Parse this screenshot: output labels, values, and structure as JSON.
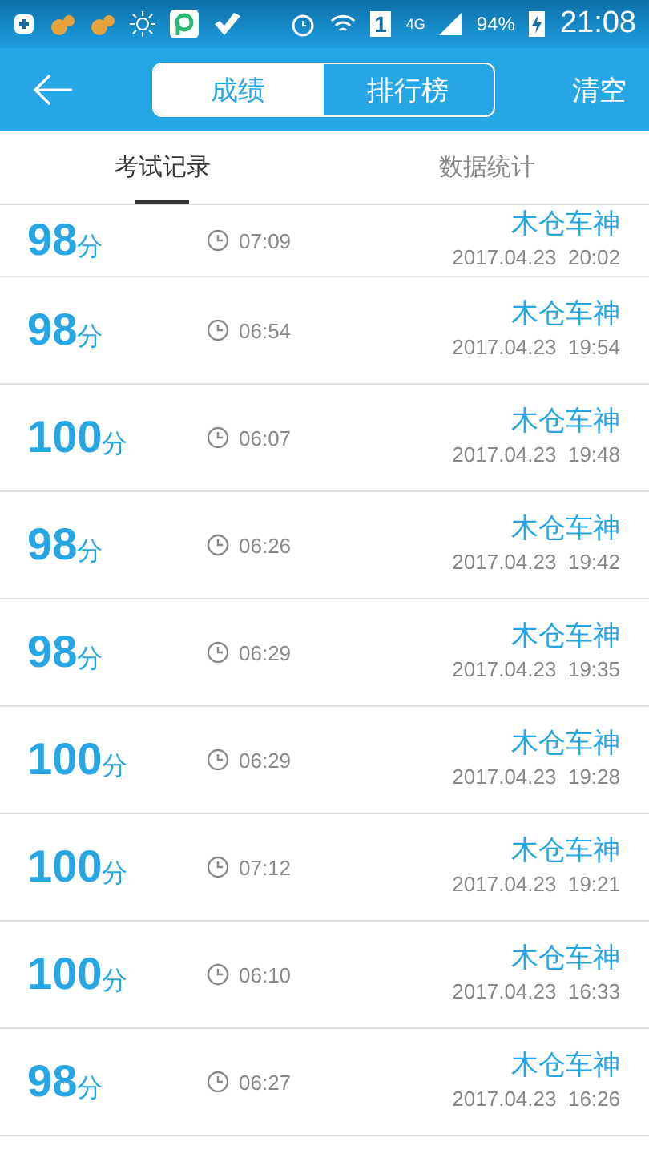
{
  "status_bar": {
    "sim": "1",
    "network": "4G",
    "battery": "94%",
    "time": "21:08"
  },
  "header": {
    "segments": [
      {
        "label": "成绩",
        "selected": true
      },
      {
        "label": "排行榜",
        "selected": false
      }
    ],
    "action": "清空"
  },
  "tabs": [
    {
      "label": "考试记录",
      "selected": true
    },
    {
      "label": "数据统计",
      "selected": false
    }
  ],
  "records": [
    {
      "score": "98",
      "unit": "分",
      "duration": "07:09",
      "name": "木仓车神",
      "date": "2017.04.23  20:02"
    },
    {
      "score": "98",
      "unit": "分",
      "duration": "06:54",
      "name": "木仓车神",
      "date": "2017.04.23  19:54"
    },
    {
      "score": "100",
      "unit": "分",
      "duration": "06:07",
      "name": "木仓车神",
      "date": "2017.04.23  19:48"
    },
    {
      "score": "98",
      "unit": "分",
      "duration": "06:26",
      "name": "木仓车神",
      "date": "2017.04.23  19:42"
    },
    {
      "score": "98",
      "unit": "分",
      "duration": "06:29",
      "name": "木仓车神",
      "date": "2017.04.23  19:35"
    },
    {
      "score": "100",
      "unit": "分",
      "duration": "06:29",
      "name": "木仓车神",
      "date": "2017.04.23  19:28"
    },
    {
      "score": "100",
      "unit": "分",
      "duration": "07:12",
      "name": "木仓车神",
      "date": "2017.04.23  19:21"
    },
    {
      "score": "100",
      "unit": "分",
      "duration": "06:10",
      "name": "木仓车神",
      "date": "2017.04.23  16:33"
    },
    {
      "score": "98",
      "unit": "分",
      "duration": "06:27",
      "name": "木仓车神",
      "date": "2017.04.23  16:26"
    }
  ]
}
